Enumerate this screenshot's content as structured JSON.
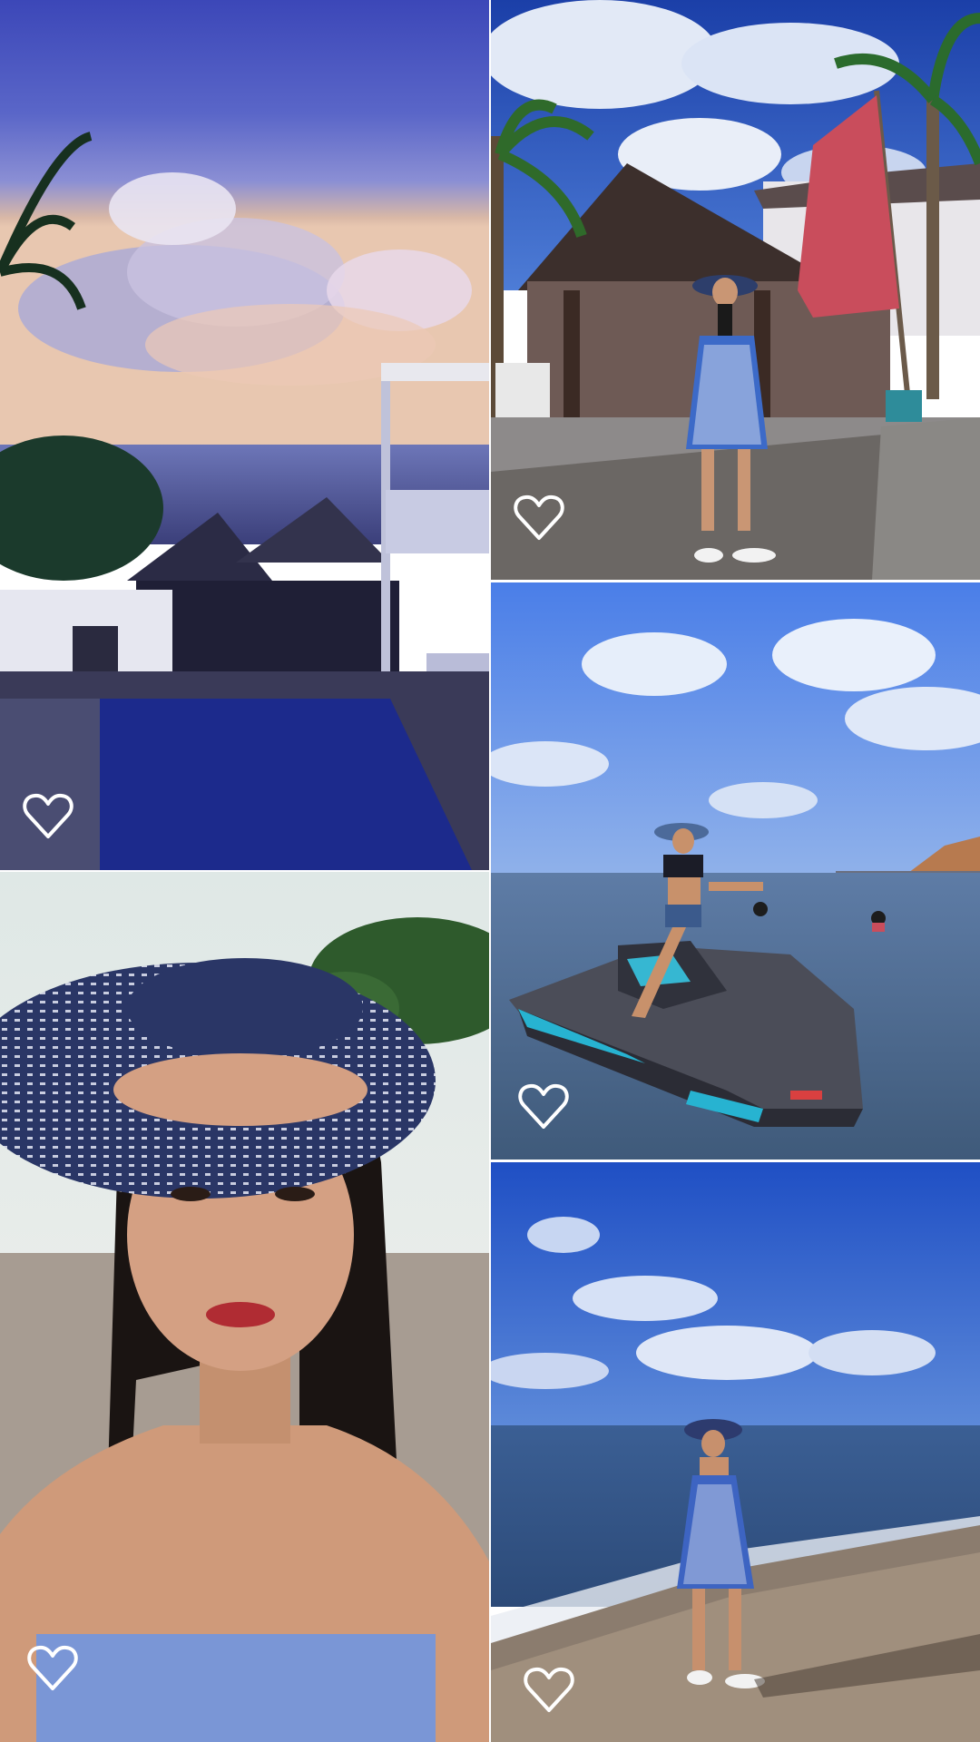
{
  "gallery": {
    "photos": [
      {
        "id": "photo-1",
        "subject": "resort-pool-sunset",
        "liked": false
      },
      {
        "id": "photo-2",
        "subject": "woman-by-hut-with-flag",
        "liked": false
      },
      {
        "id": "photo-3",
        "subject": "woman-on-jet-ski",
        "liked": false
      },
      {
        "id": "photo-4",
        "subject": "selfie-with-hat",
        "liked": false
      },
      {
        "id": "photo-5",
        "subject": "woman-on-beach",
        "liked": false
      }
    ],
    "like_icon": "heart-outline-icon",
    "like_icon_color": "#ffffff"
  }
}
